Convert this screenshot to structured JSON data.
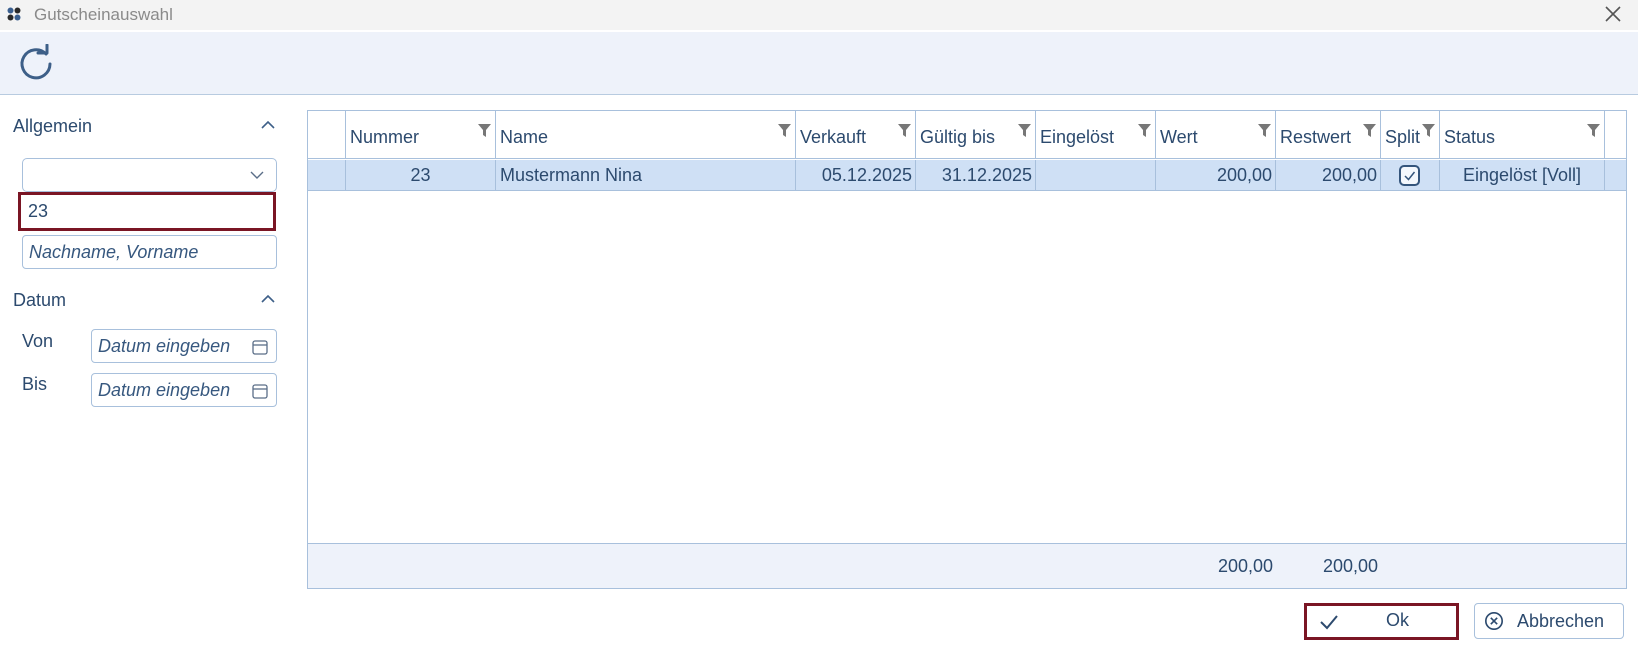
{
  "window": {
    "title": "Gutscheinauswahl",
    "icon": "app-grid-icon",
    "close_icon": "close-icon"
  },
  "toolbar": {
    "refresh_icon": "refresh-icon"
  },
  "filter": {
    "general": {
      "title": "Allgemein",
      "select_value": "",
      "number_value": "23",
      "name_placeholder": "Nachname, Vorname"
    },
    "date": {
      "title": "Datum",
      "from_label": "Von",
      "to_label": "Bis",
      "from_placeholder": "Datum eingeben",
      "to_placeholder": "Datum eingeben"
    }
  },
  "grid": {
    "columns": [
      "",
      "Nummer",
      "Name",
      "Verkauft",
      "Gültig bis",
      "Eingelöst",
      "Wert",
      "Restwert",
      "Split",
      "Status"
    ],
    "rows": [
      {
        "nummer": "23",
        "name": "Mustermann Nina",
        "verkauft": "05.12.2025",
        "gueltig_bis": "31.12.2025",
        "eingeloest": "",
        "wert": "200,00",
        "restwert": "200,00",
        "split": true,
        "status": "Eingelöst [Voll]"
      }
    ],
    "totals": {
      "wert": "200,00",
      "restwert": "200,00"
    }
  },
  "buttons": {
    "ok": "Ok",
    "cancel": "Abbrechen"
  },
  "colors": {
    "accent": "#2c4a6e",
    "highlight": "#7a1524",
    "selected_row": "#cfe0f5",
    "border": "#a8c0dc"
  }
}
